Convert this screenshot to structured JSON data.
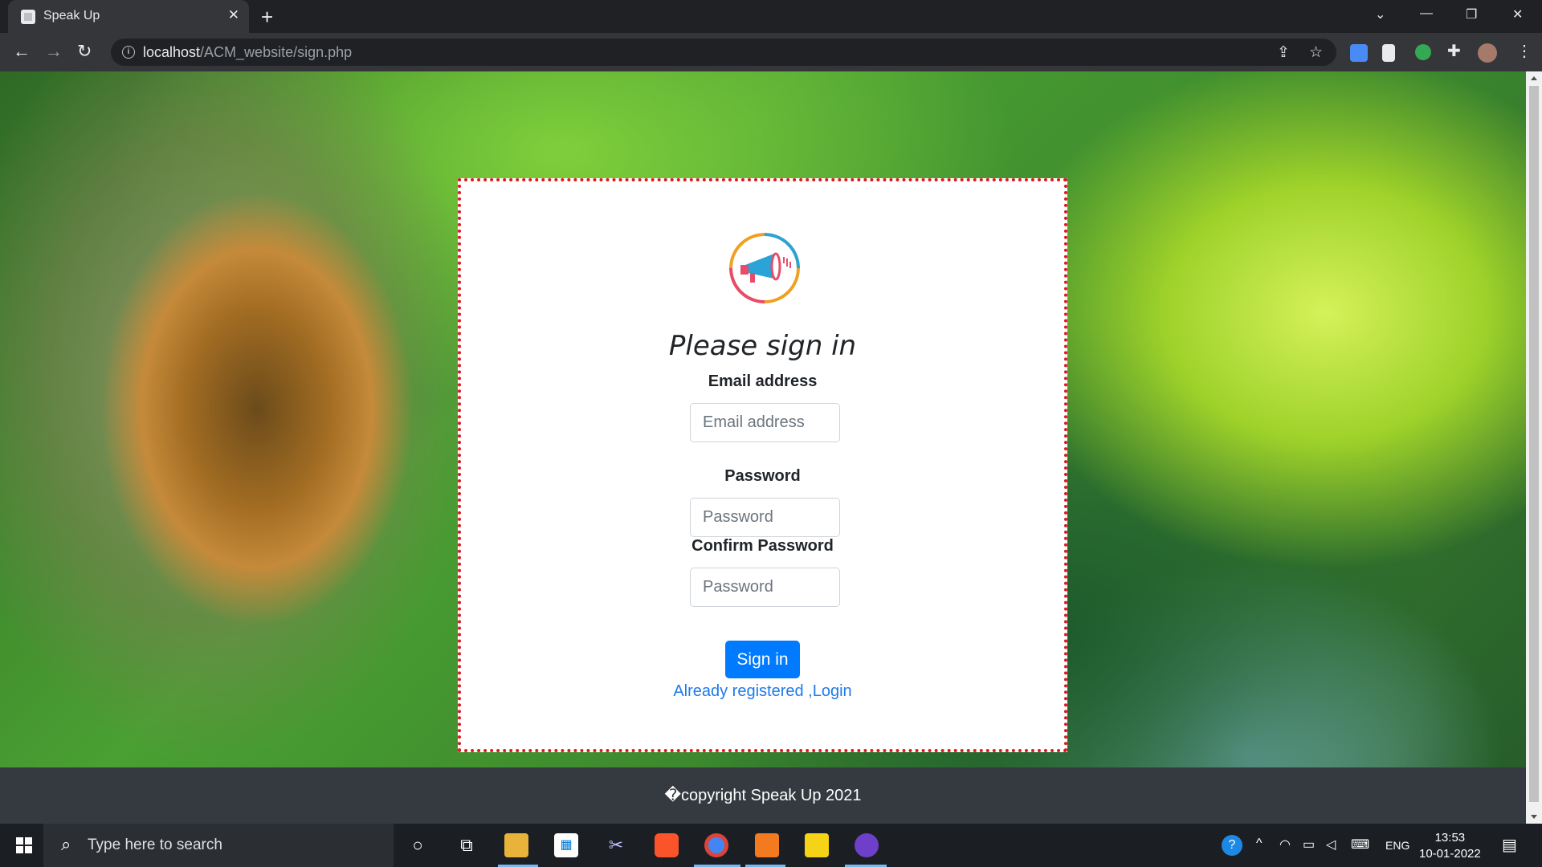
{
  "browser": {
    "tab_title": "Speak Up",
    "tab_close": "✕",
    "new_tab": "+",
    "url_host": "localhost",
    "url_path": "/ACM_website/sign.php"
  },
  "page": {
    "heading": "Please sign in",
    "email_label": "Email address",
    "email_placeholder": "Email address",
    "password_label": "Password",
    "password_placeholder": "Password",
    "confirm_label": "Confirm Password",
    "confirm_placeholder": "Password",
    "signin_button": "Sign in",
    "login_link": "Already registered ,Login",
    "footer": "�copyright Speak Up 2021"
  },
  "taskbar": {
    "search_placeholder": "Type here to search",
    "language": "ENG",
    "time": "13:53",
    "date": "10-01-2022"
  },
  "colors": {
    "card_border": "#e0171b",
    "button": "#007bff",
    "link": "#1e7be8",
    "footer_bg": "#343a40"
  }
}
